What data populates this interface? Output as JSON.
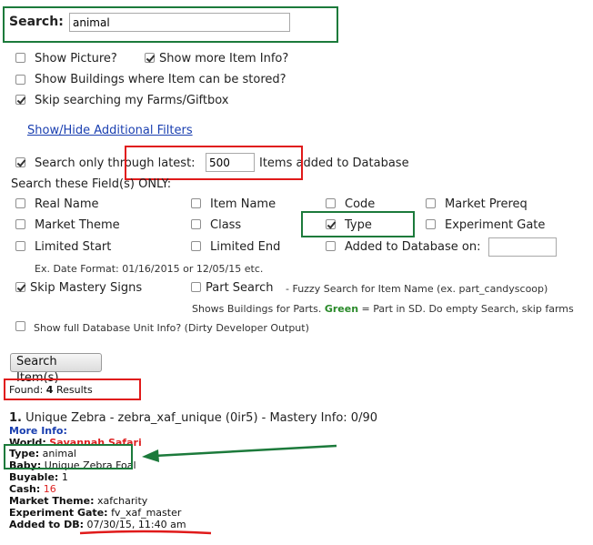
{
  "search": {
    "label": "Search:",
    "value": "animal"
  },
  "options": {
    "show_picture": {
      "label": "Show Picture?",
      "checked": false
    },
    "show_more_info": {
      "label": "Show more Item Info?",
      "checked": true
    },
    "show_buildings": {
      "label": "Show Buildings where Item can be stored?",
      "checked": false
    },
    "skip_farms": {
      "label": "Skip searching my Farms/Giftbox",
      "checked": true
    }
  },
  "filters_link": "Show/Hide Additional Filters",
  "latest": {
    "prefix": "Search only through latest:",
    "value": "500",
    "suffix": "Items added to Database",
    "checked": true
  },
  "fields_heading": "Search these Field(s) ONLY:",
  "fields": {
    "real_name": "Real Name",
    "item_name": "Item Name",
    "code": "Code",
    "market_prereq": "Market Prereq",
    "market_theme": "Market Theme",
    "class": "Class",
    "type": "Type",
    "experiment_gate": "Experiment Gate",
    "limited_start": "Limited Start",
    "limited_end": "Limited End",
    "added_to_db": "Added to Database on:"
  },
  "date_format": "Ex. Date Format: 01/16/2015 or 12/05/15 etc.",
  "skip_mastery": "Skip Mastery Signs",
  "part_search": "Part Search",
  "part_search_desc": "- Fuzzy Search for Item Name (ex. part_candyscoop)",
  "buildings_parts": {
    "before": "Shows Buildings for Parts.",
    "green": "Green",
    "after": "= Part in SD. Do empty Search, skip farms"
  },
  "full_info": "Show full Database Unit Info? (Dirty Developer Output)",
  "search_button": "Search Item(s)",
  "found": {
    "prefix": "Found:",
    "count": "4",
    "suffix": "Results"
  },
  "result": {
    "index": "1.",
    "title": "Unique Zebra - zebra_xaf_unique (0ir5) - Mastery Info: 0/90",
    "more_info": "More Info:",
    "world_label": "World:",
    "world_value": "Savannah Safari",
    "type_label": "Type:",
    "type_value": "animal",
    "baby_label": "Baby:",
    "baby_value": "Unique Zebra Foal",
    "buyable_label": "Buyable:",
    "buyable_value": "1",
    "cash_label": "Cash:",
    "cash_value": "16",
    "theme_label": "Market Theme:",
    "theme_value": "xafcharity",
    "gate_label": "Experiment Gate:",
    "gate_value": "fv_xaf_master",
    "added_label": "Added to DB:",
    "added_value": "07/30/15, 11:40 am"
  },
  "colors": {
    "green_box": "#1c7a3b",
    "red_box": "#e01a1a",
    "link": "#1a3fb0"
  }
}
